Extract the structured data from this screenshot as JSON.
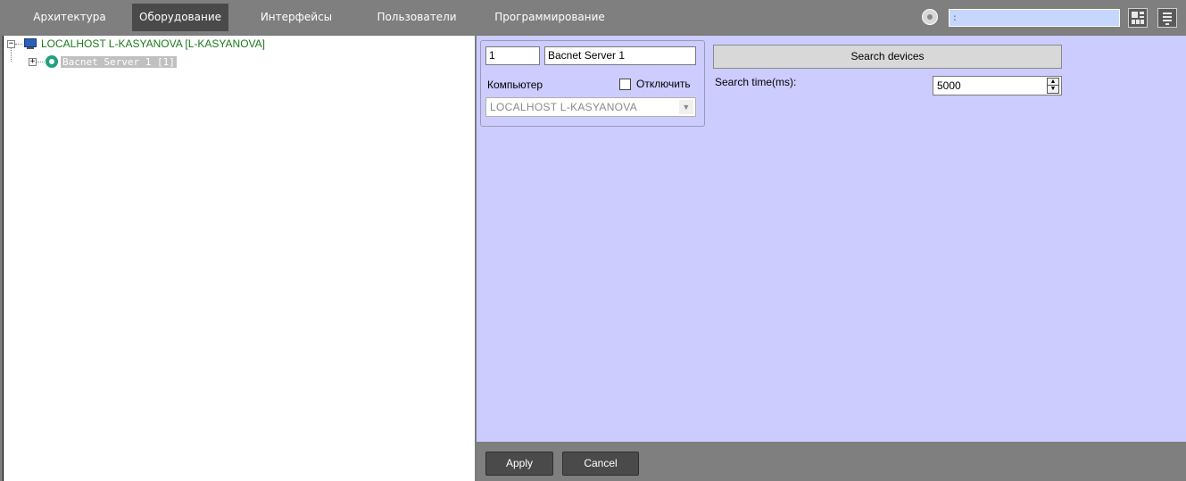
{
  "tabs": [
    {
      "label": "Архитектура",
      "active": false
    },
    {
      "label": "Оборудование",
      "active": true
    },
    {
      "label": "Интерфейсы",
      "active": false
    },
    {
      "label": "Пользователи",
      "active": false
    },
    {
      "label": "Программирование",
      "active": false
    }
  ],
  "search": {
    "value": ":"
  },
  "tree": {
    "root_label": "LOCALHOST L-KASYANOVA [L-KASYANOVA]",
    "root_expander": "−",
    "child_label": "Bacnet Server 1 [1]",
    "child_expander": "+"
  },
  "form": {
    "id_value": "1",
    "name_value": "Bacnet Server 1",
    "computer_label": "Компьютер",
    "disable_label": "Отключить",
    "disable_checked": false,
    "computer_value": "LOCALHOST L-KASYANOVA",
    "search_button": "Search devices",
    "search_time_label": "Search time(ms):",
    "search_time_value": "5000"
  },
  "footer": {
    "apply_label": "Apply",
    "cancel_label": "Cancel"
  },
  "colors": {
    "topbar": "#7f7f7f",
    "active_tab": "#4a4a4a",
    "panel": "#ccccff",
    "search_field": "#c5d6ff",
    "tree_root_text": "#1a7a1a"
  }
}
